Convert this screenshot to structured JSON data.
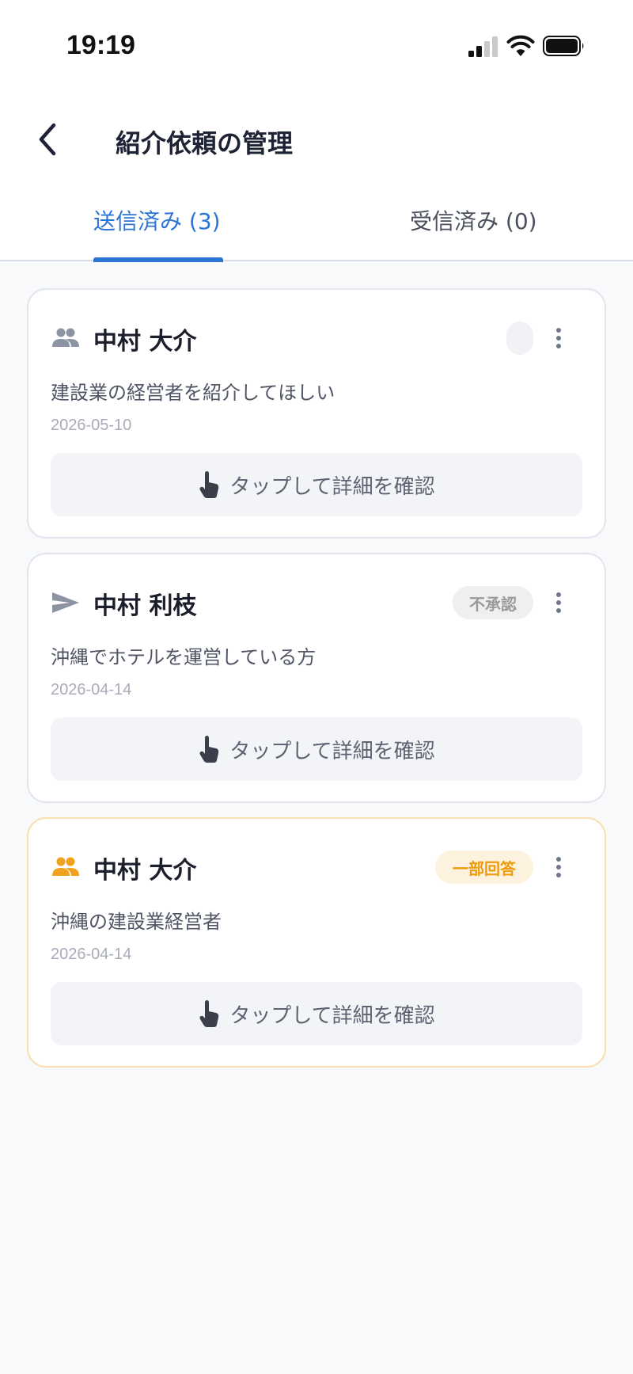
{
  "status_bar": {
    "time": "19:19"
  },
  "header": {
    "title": "紹介依頼の管理",
    "tabs": [
      {
        "label": "送信済み (3)",
        "active": true
      },
      {
        "label": "受信済み (0)",
        "active": false
      }
    ]
  },
  "colors": {
    "accent": "#2b74d6",
    "partial": "#ef9a0c",
    "rejected": "#9a9a9a"
  },
  "cards": [
    {
      "icon": "people-icon",
      "name": "中村 大介",
      "badge": "",
      "description": "建設業の経営者を紹介してほしい",
      "date": "2026-05-10",
      "action": "タップして詳細を確認"
    },
    {
      "icon": "send-icon",
      "name": "中村 利枝",
      "badge": "不承認",
      "description": "沖縄でホテルを運営している方",
      "date": "2026-04-14",
      "action": "タップして詳細を確認"
    },
    {
      "icon": "people-icon",
      "name": "中村 大介",
      "badge": "一部回答",
      "description": "沖縄の建設業経営者",
      "date": "2026-04-14",
      "action": "タップして詳細を確認"
    }
  ]
}
